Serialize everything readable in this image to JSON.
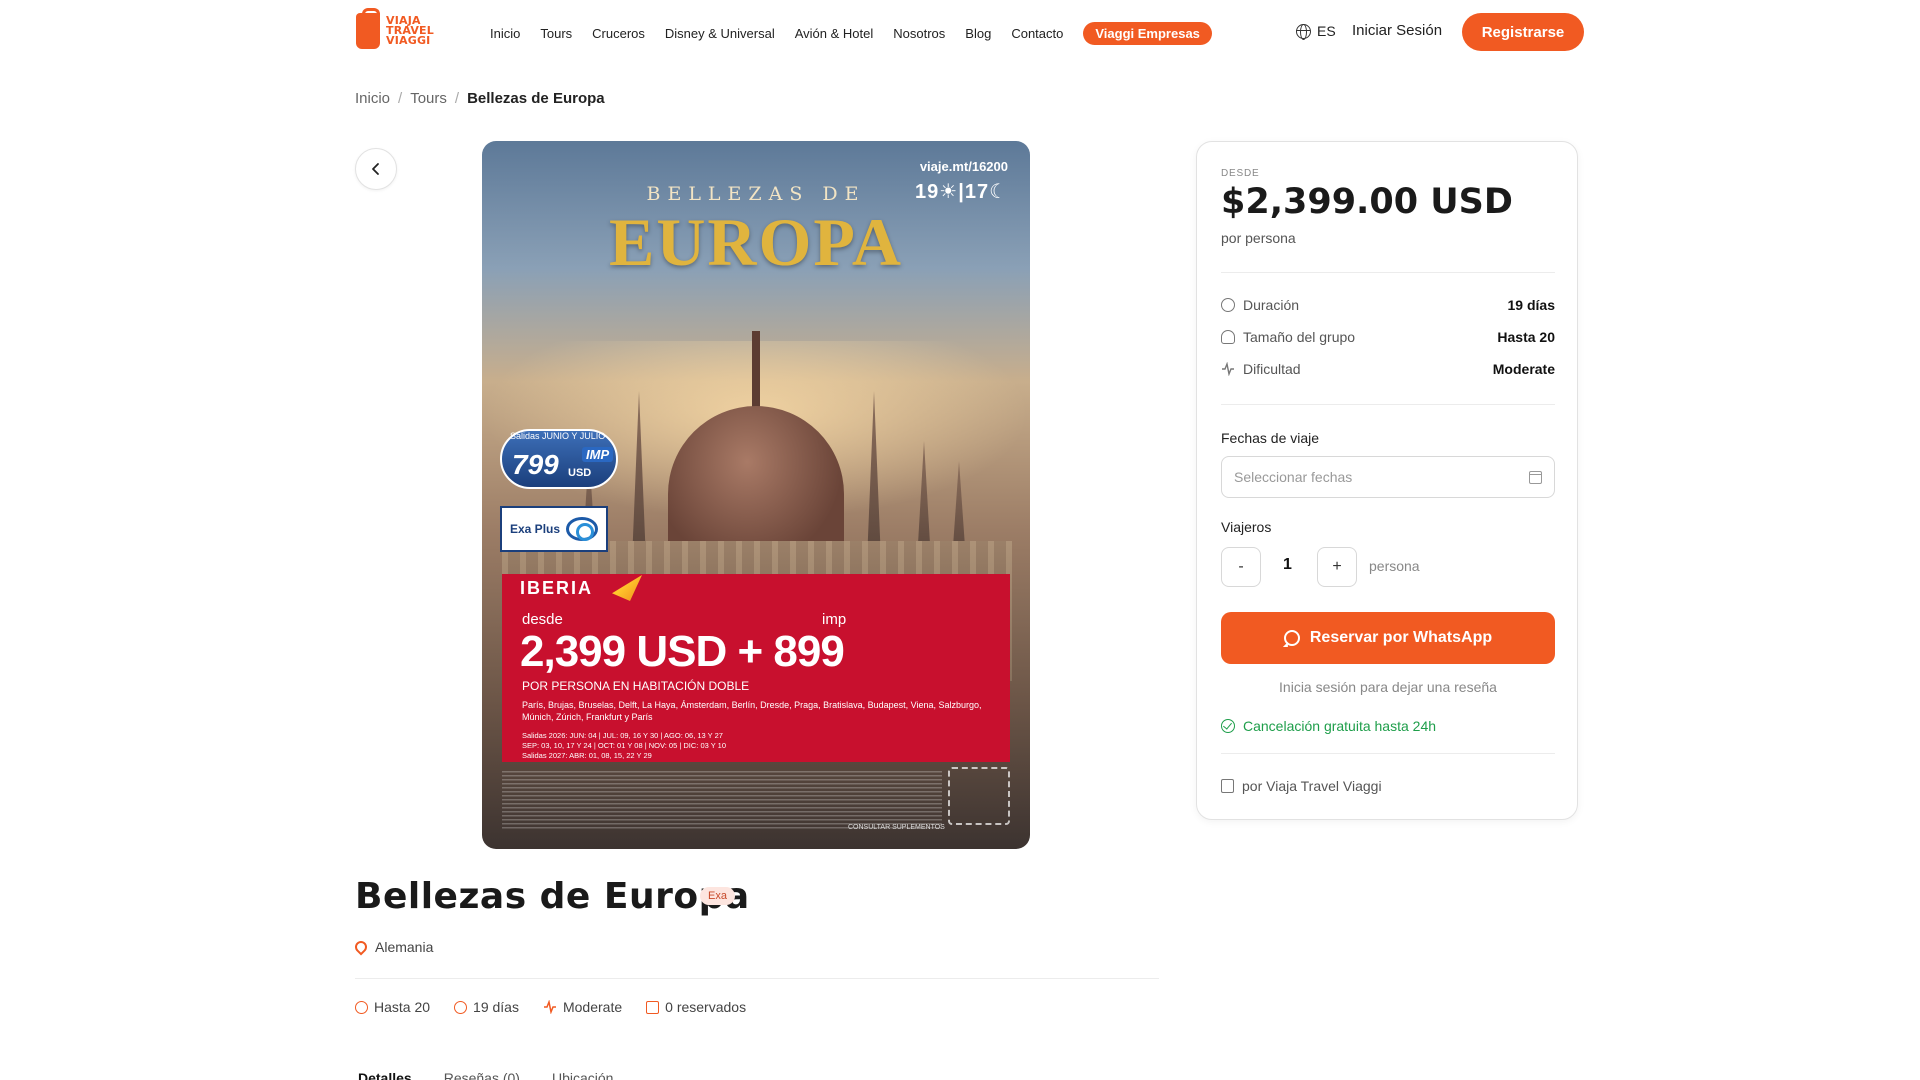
{
  "header": {
    "logo_lines": [
      "VIAJA",
      "TRAVEL",
      "VIAGGI"
    ],
    "nav": [
      "Inicio",
      "Tours",
      "Cruceros",
      "Disney & Universal",
      "Avión & Hotel",
      "Nosotros",
      "Blog",
      "Contacto"
    ],
    "nav_pill": "Viaggi Empresas",
    "language": "ES",
    "login": "Iniciar Sesión",
    "register": "Registrarse"
  },
  "breadcrumb": {
    "items": [
      "Inicio",
      "Tours"
    ],
    "current": "Bellezas de Europa"
  },
  "poster": {
    "url_text": "viaje.mt/16200",
    "days_nights": "19☀|17☾",
    "subtitle": "BELLEZAS DE",
    "title": "EUROPA",
    "badge_salidas": "Salidas JUNIO Y JULIO",
    "badge_price": "799",
    "badge_usd": "USD",
    "badge_imp": "IMP",
    "exaplus": "Exa Plus",
    "airline": "IBERIA",
    "desde": "desde",
    "imp": "imp",
    "price_line": "2,399 USD + 899",
    "per_person": "POR PERSONA EN HABITACIÓN DOBLE",
    "cities": "París, Brujas, Bruselas, Delft, La Haya, Ámsterdam, Berlín, Dresde, Praga, Bratislava, Budapest, Viena, Salzburgo, Múnich, Zúrich, Frankfurt y París",
    "dates_1": "Salidas 2026: JUN: 04 | JUL: 09, 16 Y 30 | AGO: 06, 13 Y 27",
    "dates_2": "SEP: 03, 10, 17 Y 24 | OCT: 01 Y 08 | NOV: 05 | DIC: 03 Y 10",
    "dates_3": "Salidas 2027: ABR: 01, 08, 15, 22 Y 29",
    "consult": "CONSULTAR SUPLEMENTOS"
  },
  "tour": {
    "title": "Bellezas de Europa",
    "tag": "Exa",
    "location": "Alemania",
    "stats": [
      "Hasta 20",
      "19 días",
      "Moderate",
      "0 reservados"
    ],
    "tabs": [
      "Detalles",
      "Reseñas (0)",
      "Ubicación"
    ]
  },
  "booking": {
    "desde": "DESDE",
    "price": "$2,399.00 USD",
    "per": "por persona",
    "duration_label": "Duración",
    "duration_value": "19 días",
    "group_label": "Tamaño del grupo",
    "group_value": "Hasta 20",
    "difficulty_label": "Dificultad",
    "difficulty_value": "Moderate",
    "dates_label": "Fechas de viaje",
    "dates_placeholder": "Seleccionar fechas",
    "travelers_label": "Viajeros",
    "minus": "-",
    "plus": "+",
    "qty": "1",
    "qty_unit": "persona",
    "whatsapp": "Reservar por WhatsApp",
    "review_note": "Inicia sesión para dejar una reseña",
    "cancellation": "Cancelación gratuita hasta 24h",
    "byline": "por Viaja Travel Viaggi"
  },
  "colors": {
    "accent": "#f15a22",
    "success": "#1e9e4a",
    "poster_red": "#c8102e"
  }
}
